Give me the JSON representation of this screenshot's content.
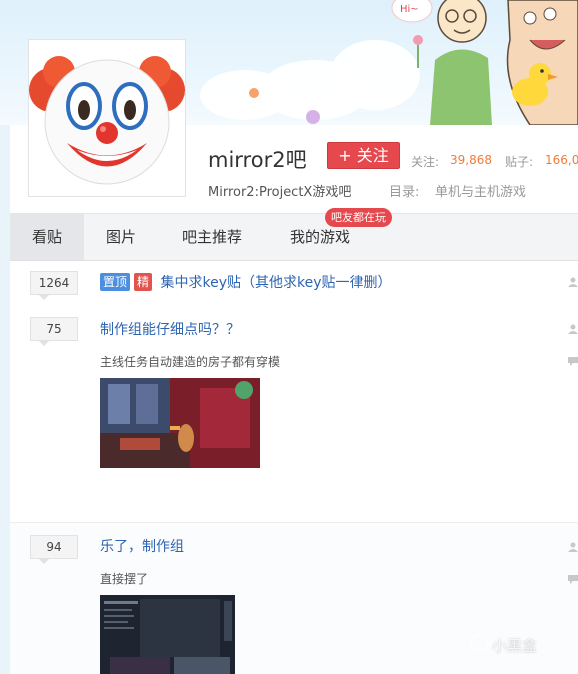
{
  "forum": {
    "name": "mirror2吧",
    "subtitle": "Mirror2:ProjectX游戏吧",
    "follow_label": "+ 关注",
    "follow_label_color": "#e5484d",
    "stats": {
      "follow_label": "关注:",
      "follow_value": "39,868",
      "posts_label": "贴子:",
      "posts_value": "166,00"
    },
    "catalog_label": "目录:",
    "catalog_value": "单机与主机游戏",
    "avatar_icon": "clown-face-icon"
  },
  "tabs": [
    {
      "label": "看贴",
      "active": true
    },
    {
      "label": "图片",
      "active": false
    },
    {
      "label": "吧主推荐",
      "active": false
    },
    {
      "label": "我的游戏",
      "active": false
    }
  ],
  "tab_badge": "吧友都在玩",
  "threads": [
    {
      "reply_count": "1264",
      "tags": [
        "置顶",
        "精"
      ],
      "title": "集中求key贴（其他求key贴一律删）"
    },
    {
      "reply_count": "75",
      "title": "制作组能仔细点吗？？",
      "abstract": "主线任务自动建造的房子都有穿模"
    },
    {
      "reply_count": "94",
      "title": "乐了，制作组",
      "abstract": "直接摆了"
    }
  ],
  "watermark": "小黑盒",
  "colors": {
    "accent_red": "#e5484d",
    "link_blue": "#2d64b3",
    "stat_orange": "#f07c3c"
  }
}
